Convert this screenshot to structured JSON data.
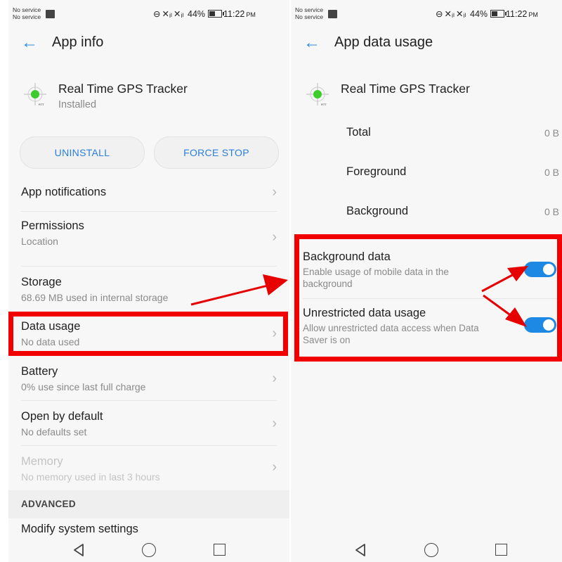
{
  "status_bar": {
    "service_line1": "No service",
    "service_line2": "No service",
    "battery_percent": "44%",
    "time": "11:22",
    "ampm": "PM",
    "icons": [
      "image-icon",
      "dnd-icon",
      "no-signal-icon",
      "signal-x-icon",
      "battery-icon"
    ]
  },
  "left": {
    "title": "App info",
    "app_name": "Real Time GPS Tracker",
    "app_status": "Installed",
    "uninstall_label": "UNINSTALL",
    "force_stop_label": "FORCE STOP",
    "items": [
      {
        "title": "App notifications",
        "subtitle": ""
      },
      {
        "title": "Permissions",
        "subtitle": "Location"
      },
      {
        "title": "Storage",
        "subtitle": "68.69 MB used in internal storage"
      },
      {
        "title": "Data usage",
        "subtitle": "No data used"
      },
      {
        "title": "Battery",
        "subtitle": "0% use since last full charge"
      },
      {
        "title": "Open by default",
        "subtitle": "No defaults set"
      },
      {
        "title": "Memory",
        "subtitle": "No memory used in last 3 hours"
      }
    ],
    "section_advanced": "ADVANCED",
    "modify_settings": "Modify system settings"
  },
  "right": {
    "title": "App data usage",
    "app_name": "Real Time GPS Tracker",
    "usage": [
      {
        "label": "Total",
        "value": "0 B"
      },
      {
        "label": "Foreground",
        "value": "0 B"
      },
      {
        "label": "Background",
        "value": "0 B"
      }
    ],
    "background_data": {
      "title": "Background data",
      "desc": "Enable usage of mobile data in the background",
      "enabled": true
    },
    "unrestricted": {
      "title": "Unrestricted data usage",
      "desc": "Allow unrestricted data access when Data Saver is on",
      "enabled": true
    }
  },
  "colors": {
    "accent": "#1e88e5",
    "annotation": "#f20000"
  }
}
